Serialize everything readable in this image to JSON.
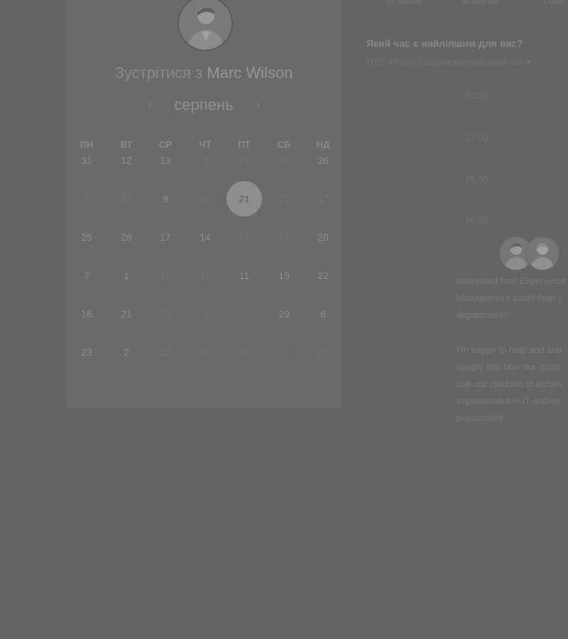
{
  "durations": [
    "15 хвилин",
    "30 хвилин",
    "1 годи"
  ],
  "meeting": {
    "title_prefix": "Зустрітися з",
    "host_name": "Marc Wilson"
  },
  "calendar": {
    "month": "серпень",
    "prev_icon": "chevron-left-icon",
    "next_icon": "chevron-right-icon",
    "weekdays": [
      "ПН",
      "ВТ",
      "СР",
      "ЧТ",
      "ПТ",
      "СБ",
      "НД"
    ],
    "weeks": [
      [
        {
          "d": "31",
          "s": "on"
        },
        {
          "d": "12",
          "s": "on"
        },
        {
          "d": "13",
          "s": "on"
        },
        {
          "d": "4",
          "s": "off"
        },
        {
          "d": "22",
          "s": "off"
        },
        {
          "d": "26",
          "s": "off"
        },
        {
          "d": "26",
          "s": "on"
        }
      ],
      [
        {
          "d": "8",
          "s": "off"
        },
        {
          "d": "10",
          "s": "off"
        },
        {
          "d": "9",
          "s": "on"
        },
        {
          "d": "10",
          "s": "off"
        },
        {
          "d": "21",
          "s": "sel"
        },
        {
          "d": "27",
          "s": "off"
        },
        {
          "d": "17",
          "s": "off"
        }
      ],
      [
        {
          "d": "25",
          "s": "on"
        },
        {
          "d": "28",
          "s": "on"
        },
        {
          "d": "17",
          "s": "on"
        },
        {
          "d": "14",
          "s": "on"
        },
        {
          "d": "27",
          "s": "off"
        },
        {
          "d": "27",
          "s": "off"
        },
        {
          "d": "20",
          "s": "on"
        }
      ],
      [
        {
          "d": "7",
          "s": "on"
        },
        {
          "d": "1",
          "s": "on"
        },
        {
          "d": "18",
          "s": "off"
        },
        {
          "d": "16",
          "s": "off"
        },
        {
          "d": "11",
          "s": "on"
        },
        {
          "d": "15",
          "s": "on"
        },
        {
          "d": "22",
          "s": "on"
        }
      ],
      [
        {
          "d": "16",
          "s": "on"
        },
        {
          "d": "21",
          "s": "on"
        },
        {
          "d": "23",
          "s": "off"
        },
        {
          "d": "8",
          "s": "off"
        },
        {
          "d": "20",
          "s": "off"
        },
        {
          "d": "29",
          "s": "on"
        },
        {
          "d": "6",
          "s": "on"
        }
      ],
      [
        {
          "d": "23",
          "s": "on"
        },
        {
          "d": "2",
          "s": "on"
        },
        {
          "d": "22",
          "s": "off"
        },
        {
          "d": "26",
          "s": "off"
        },
        {
          "d": "30",
          "s": "off"
        },
        {
          "d": "5",
          "s": "off"
        },
        {
          "d": "25",
          "s": "off"
        }
      ]
    ]
  },
  "time_panel": {
    "question": "Який час є найліпшим для вас?",
    "timezone": "UTC +03:00 Східноєвропейський час",
    "timezone_icon": "caret-down-icon",
    "slots": [
      "10:30",
      "12:00",
      "15:00",
      "16:30"
    ]
  },
  "host_info": {
    "avatars": [
      "host-avatar-1",
      "host-avatar-2"
    ],
    "paragraph1": [
      "Interested how Experience",
      "Management could help y",
      "department?"
    ],
    "paragraph2": [
      "I'm happy to help and sha",
      "insight into how our custo",
      "use our platform to achiev",
      "improvement in IT end-us",
      "productivity."
    ]
  }
}
